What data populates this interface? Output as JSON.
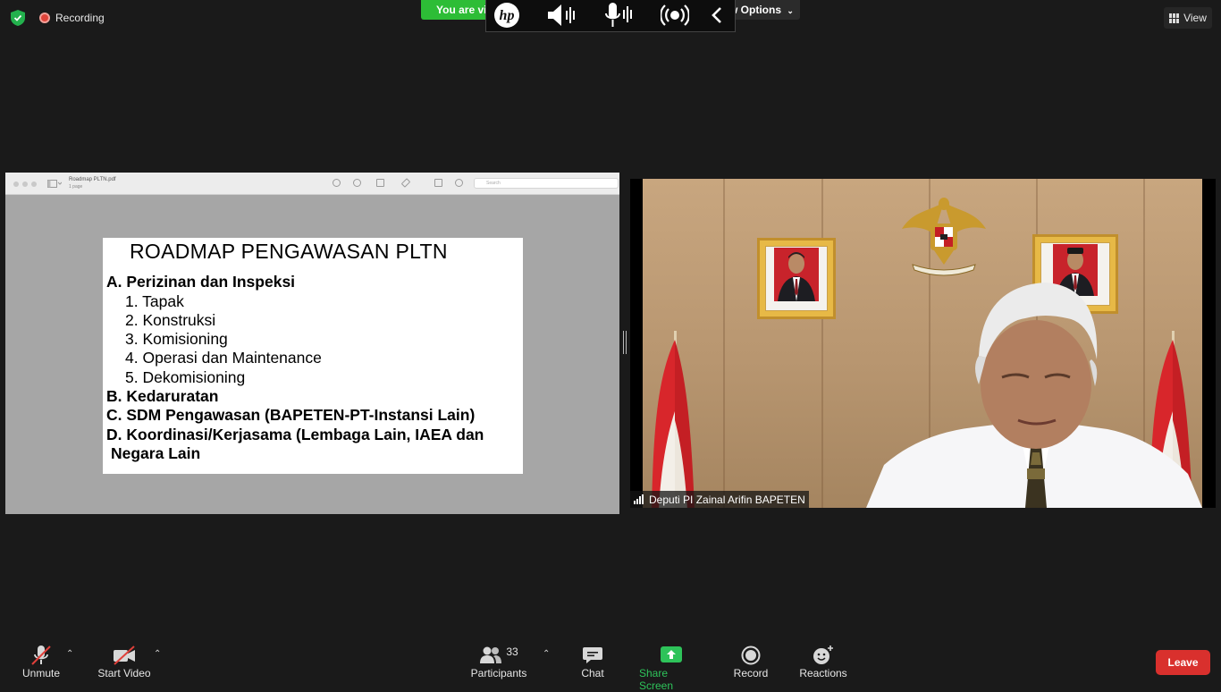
{
  "topbar": {
    "recording_label": "Recording",
    "banner_label": "You are vi",
    "view_options_label": "w Options",
    "view_button_label": "View"
  },
  "hp_osd": {
    "logo_text": "hp"
  },
  "shared_screen": {
    "pdf_filename": "Roadmap PLTN.pdf",
    "pdf_pages": "1 page",
    "search_placeholder": "Search",
    "document": {
      "title": "ROADMAP PENGAWASAN PLTN",
      "lines": [
        {
          "text": "A. Perizinan dan Inspeksi",
          "bold": true
        },
        {
          "text": "1. Tapak",
          "bold": false
        },
        {
          "text": "2. Konstruksi",
          "bold": false
        },
        {
          "text": "3. Komisioning",
          "bold": false
        },
        {
          "text": "4. Operasi dan Maintenance",
          "bold": false
        },
        {
          "text": "5. Dekomisioning",
          "bold": false
        },
        {
          "text": "B. Kedaruratan",
          "bold": true
        },
        {
          "text": "C. SDM Pengawasan (BAPETEN-PT-Instansi Lain)",
          "bold": true
        },
        {
          "text": "D. Koordinasi/Kerjasama (Lembaga Lain,  IAEA dan",
          "bold": true
        },
        {
          "text": "Negara Lain",
          "bold": true
        }
      ]
    }
  },
  "video": {
    "participant_name": "Deputi PI Zainal Arifin BAPETEN"
  },
  "toolbar": {
    "unmute_label": "Unmute",
    "start_video_label": "Start Video",
    "participants_label": "Participants",
    "participants_count": "33",
    "chat_label": "Chat",
    "share_screen_label": "Share Screen",
    "record_label": "Record",
    "reactions_label": "Reactions",
    "leave_label": "Leave"
  },
  "colors": {
    "background": "#1a1a1a",
    "banner_green": "#2dbd36",
    "share_green": "#2ec35a",
    "leave_red": "#d9302d",
    "recording_red": "#e0443a"
  }
}
